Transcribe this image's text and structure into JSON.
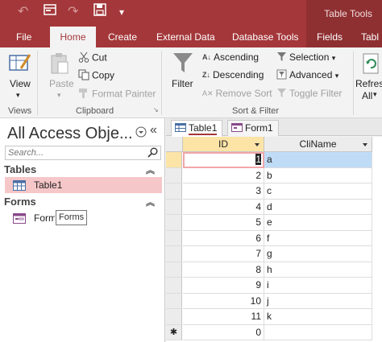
{
  "quick_access": {
    "undo": "↶",
    "redo": "↷",
    "save": "save",
    "customize": "▾"
  },
  "context_title": "Table Tools",
  "tabs": [
    "File",
    "Home",
    "Create",
    "External Data",
    "Database Tools",
    "Fields",
    "Tabl"
  ],
  "ribbon": {
    "views": {
      "view": "View",
      "group": "Views"
    },
    "clipboard": {
      "paste": "Paste",
      "cut": "Cut",
      "copy": "Copy",
      "format_painter": "Format Painter",
      "group": "Clipboard"
    },
    "sort_filter": {
      "filter": "Filter",
      "ascending": "Ascending",
      "descending": "Descending",
      "remove_sort": "Remove Sort",
      "selection": "Selection",
      "advanced": "Advanced",
      "toggle_filter": "Toggle Filter",
      "group": "Sort & Filter"
    },
    "records": {
      "refresh": "Refresh",
      "all": "All"
    }
  },
  "nav": {
    "title": "All Access Obje...",
    "collapse": "«",
    "search_placeholder": "Search...",
    "sections": [
      {
        "label": "Tables",
        "items": [
          "Table1"
        ]
      },
      {
        "label": "Forms",
        "items": [
          "Form1"
        ]
      }
    ],
    "tooltip": "Forms"
  },
  "doc_tabs": [
    "Table1",
    "Form1"
  ],
  "table": {
    "columns": [
      "ID",
      "CliName"
    ],
    "rows": [
      [
        "1",
        "a"
      ],
      [
        "2",
        "b"
      ],
      [
        "3",
        "c"
      ],
      [
        "4",
        "d"
      ],
      [
        "5",
        "e"
      ],
      [
        "6",
        "f"
      ],
      [
        "7",
        "g"
      ],
      [
        "8",
        "h"
      ],
      [
        "9",
        "i"
      ],
      [
        "10",
        "j"
      ],
      [
        "11",
        "k"
      ]
    ],
    "new_row_marker": "✱",
    "new_row_id": "0"
  },
  "colors": {
    "accent": "#a4373a",
    "selected_row": "#f6c7c8",
    "active_cell": "#bfdcf7",
    "header_highlight": "#fce4a7"
  }
}
